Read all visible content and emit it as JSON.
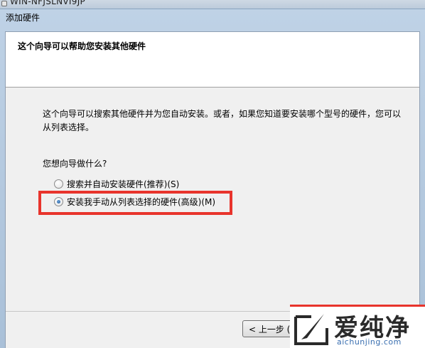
{
  "background_window": {
    "title": "WIN-NFJSLNVI9JP"
  },
  "window": {
    "title": "添加硬件"
  },
  "header": {
    "title": "这个向导可以帮助您安装其他硬件"
  },
  "body": {
    "description": "这个向导可以搜索其他硬件并为您自动安装。或者，如果您知道要安装哪个型号的硬件，您可以从列表选择。",
    "question": "您想向导做什么?",
    "options": [
      {
        "label": "搜索并自动安装硬件(推荐)(S)",
        "checked": false
      },
      {
        "label": "安装我手动从列表选择的硬件(高级)(M)",
        "checked": true
      }
    ]
  },
  "footer": {
    "back_label": "< 上一步 (B"
  },
  "watermark": {
    "brand": "爱纯净",
    "url": "aichunjing.com"
  },
  "colors": {
    "highlight": "#e8342c",
    "radio_selected": "#1f5a99"
  }
}
